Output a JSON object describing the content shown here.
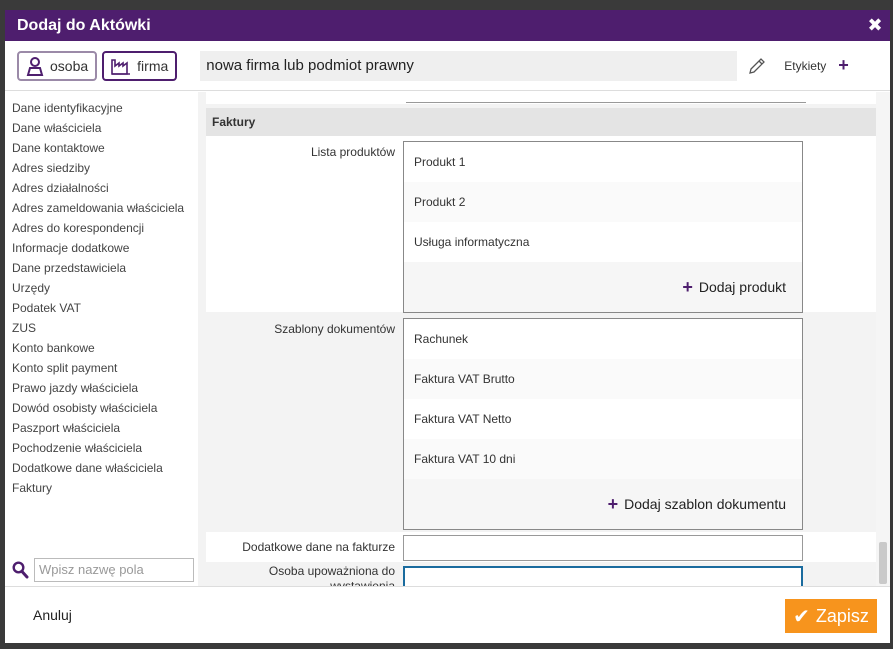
{
  "dialog": {
    "title": "Dodaj do Aktówki",
    "close_icon": "✖"
  },
  "topbar": {
    "type_person": "osoba",
    "type_company": "firma",
    "name_value": "nowa firma lub podmiot prawny",
    "tags_label": "Etykiety",
    "tags_add": "+"
  },
  "sidebar": {
    "items": [
      "Dane identyfikacyjne",
      "Dane właściciela",
      "Dane kontaktowe",
      "Adres siedziby",
      "Adres działalności",
      "Adres zameldowania właściciela",
      "Adres do korespondencji",
      "Informacje dodatkowe",
      "Dane przedstawiciela",
      "Urzędy",
      "Podatek VAT",
      "ZUS",
      "Konto bankowe",
      "Konto split payment",
      "Prawo jazdy właściciela",
      "Dowód osobisty właściciela",
      "Paszport właściciela",
      "Pochodzenie właściciela",
      "Dodatkowe dane właściciela",
      "Faktury"
    ],
    "search_placeholder": "Wpisz nazwę pola"
  },
  "content": {
    "section_title": "Faktury",
    "products": {
      "label": "Lista produktów",
      "items": [
        "Produkt 1",
        "Produkt 2",
        "Usługa informatyczna"
      ],
      "add_label": "Dodaj produkt"
    },
    "templates": {
      "label": "Szablony dokumentów",
      "items": [
        "Rachunek",
        "Faktura VAT Brutto",
        "Faktura VAT Netto",
        "Faktura VAT 10 dni"
      ],
      "add_label": "Dodaj szablon dokumentu"
    },
    "extra_label": "Dodatkowe dane na fakturze",
    "authorized_label": "Osoba upoważniona do wystawienia"
  },
  "footer": {
    "cancel_label": "Anuluj",
    "save_label": "Zapisz",
    "save_icon": "✔"
  },
  "colors": {
    "accent": "#4e1e6e",
    "save": "#f7941d",
    "focus": "#1a6b9e"
  }
}
